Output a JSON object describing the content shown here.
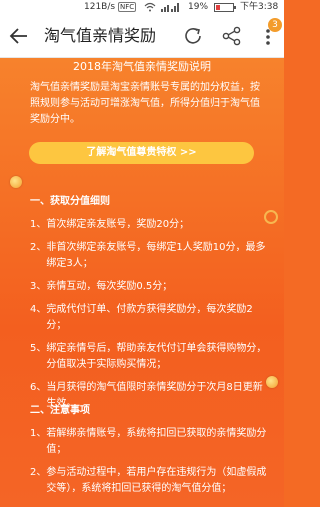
{
  "status_bar": {
    "speed": "121B/s",
    "nfc": "NFC",
    "battery": "19%",
    "time": "下午3:38"
  },
  "header": {
    "title": "淘气值亲情奖励",
    "badge_count": "3"
  },
  "page": {
    "heading": "2018年淘气值亲情奖励说明",
    "intro": "淘气值亲情奖励是淘宝亲情账号专属的加分权益，按照规则参与活动可增涨淘气值，所得分值归于淘气值奖励分中。",
    "cta_label": "了解淘气值尊贵特权 >>",
    "section1": {
      "title": "一、获取分值细则",
      "items": [
        {
          "num": "1、",
          "text": "首次绑定亲友账号，奖励20分；"
        },
        {
          "num": "2、",
          "text": "非首次绑定亲友账号，每绑定1人奖励10分，最多绑定3人；"
        },
        {
          "num": "3、",
          "text": "亲情互动，每次奖励0.5分；"
        },
        {
          "num": "4、",
          "text": "完成代付订单、付款方获得奖励分，每次奖励2分；"
        },
        {
          "num": "5、",
          "text": "绑定亲情号后，帮助亲友代付订单会获得购物分，分值取决于实际购买情况；"
        },
        {
          "num": "6、",
          "text": "当月获得的淘气值限时亲情奖励分于次月8日更新生效。"
        }
      ]
    },
    "section2": {
      "title": "二、注意事项",
      "items": [
        {
          "num": "1、",
          "text": "若解绑亲情账号，系统将扣回已获取的亲情奖励分值；"
        },
        {
          "num": "2、",
          "text": "参与活动过程中，若用户存在违规行为（如虚假成交等），系统将扣回已获得的淘气值分值；"
        }
      ]
    }
  },
  "colors": {
    "accent": "#f46a24",
    "button": "#fdc640"
  }
}
